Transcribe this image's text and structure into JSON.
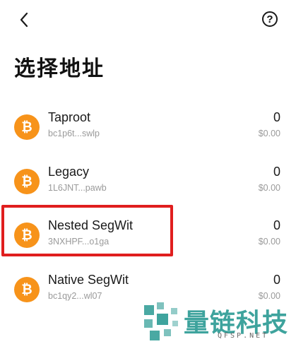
{
  "header": {
    "back_icon": "chevron-left-icon",
    "help_icon": "question-circle-icon",
    "help_glyph": "?",
    "title": "选择地址"
  },
  "addresses": [
    {
      "name": "Taproot",
      "address": "bc1p6t...swlp",
      "amount": "0",
      "fiat": "$0.00",
      "icon": "bitcoin-icon"
    },
    {
      "name": "Legacy",
      "address": "1L6JNT...pawb",
      "amount": "0",
      "fiat": "$0.00",
      "icon": "bitcoin-icon"
    },
    {
      "name": "Nested SegWit",
      "address": "3NXHPF...o1ga",
      "amount": "0",
      "fiat": "$0.00",
      "icon": "bitcoin-icon"
    },
    {
      "name": "Native SegWit",
      "address": "bc1qy2...wl07",
      "amount": "0",
      "fiat": "$0.00",
      "icon": "bitcoin-icon"
    }
  ],
  "highlight_color": "#e01e1e",
  "coin_color": "#f7931a",
  "watermark": {
    "text": "量链科技",
    "domain": "QFSP.NET",
    "color": "#2a9a93"
  }
}
